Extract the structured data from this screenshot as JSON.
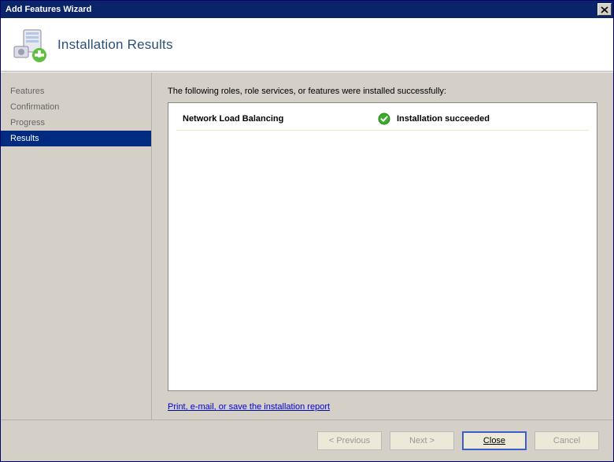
{
  "window": {
    "title": "Add Features Wizard"
  },
  "header": {
    "title": "Installation Results"
  },
  "sidebar": {
    "items": [
      {
        "label": "Features",
        "selected": false
      },
      {
        "label": "Confirmation",
        "selected": false
      },
      {
        "label": "Progress",
        "selected": false
      },
      {
        "label": "Results",
        "selected": true
      }
    ]
  },
  "main": {
    "intro": "The following roles, role services, or features were installed successfully:",
    "results": [
      {
        "name": "Network Load Balancing",
        "status": "Installation succeeded",
        "icon": "success-icon"
      }
    ],
    "report_link": "Print, e-mail, or save the installation report"
  },
  "footer": {
    "previous": "< Previous",
    "next": "Next >",
    "close_pre": "",
    "close_accel": "C",
    "close_post": "lose",
    "cancel": "Cancel"
  }
}
